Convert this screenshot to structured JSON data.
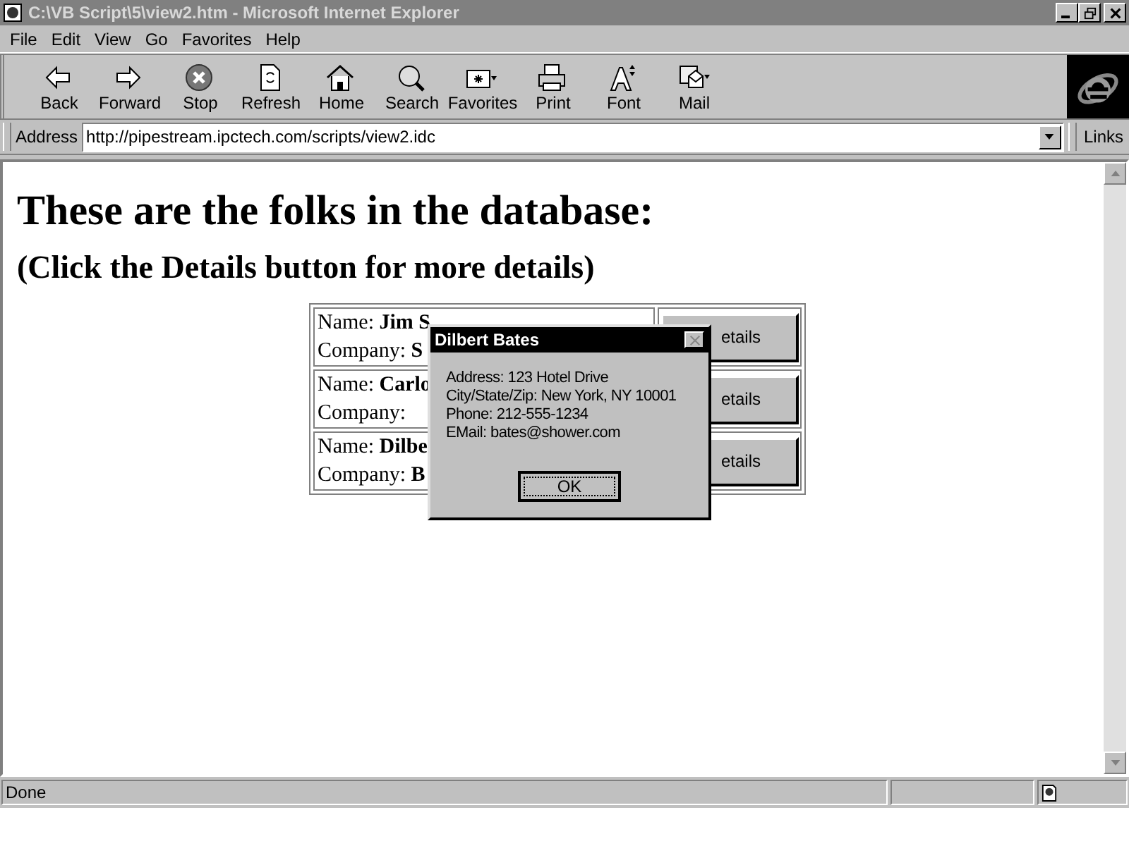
{
  "window": {
    "title": "C:\\VB Script\\5\\view2.htm - Microsoft Internet Explorer"
  },
  "menu": [
    "File",
    "Edit",
    "View",
    "Go",
    "Favorites",
    "Help"
  ],
  "toolbar": [
    {
      "label": "Back"
    },
    {
      "label": "Forward"
    },
    {
      "label": "Stop"
    },
    {
      "label": "Refresh"
    },
    {
      "label": "Home"
    },
    {
      "label": "Search"
    },
    {
      "label": "Favorites"
    },
    {
      "label": "Print"
    },
    {
      "label": "Font"
    },
    {
      "label": "Mail"
    }
  ],
  "address": {
    "label": "Address",
    "value": "http://pipestream.ipctech.com/scripts/view2.idc",
    "links": "Links"
  },
  "page": {
    "heading": "These are the folks in the database:",
    "subheading": "(Click the Details button for more details)",
    "rows": [
      {
        "name": "Name: **Jim S**",
        "company": "Company: **S**",
        "button": "etails"
      },
      {
        "name": "Name: **Carlo**",
        "company": "Company:",
        "button": "etails"
      },
      {
        "name": "Name: **Dilbe**",
        "company": "Company: **B**",
        "button": "etails"
      }
    ]
  },
  "dialog": {
    "title": "Dilbert Bates",
    "lines": [
      "Address: 123 Hotel Drive",
      "City/State/Zip: New York, NY 10001",
      "Phone: 212-555-1234",
      "EMail: bates@shower.com"
    ],
    "button": "OK"
  },
  "status_bar": {
    "text": "Done"
  }
}
